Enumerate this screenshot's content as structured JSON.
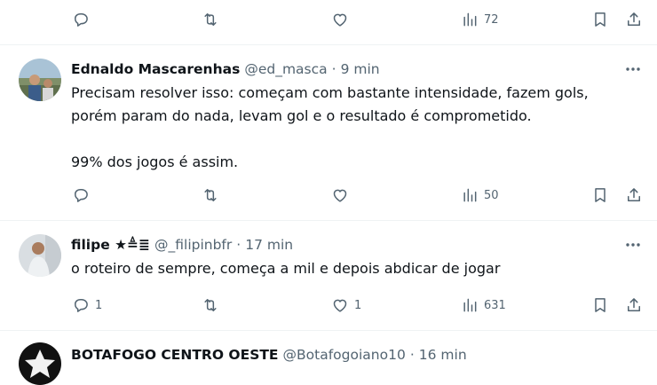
{
  "top_actions": {
    "reply_count": "",
    "retweet_count": "",
    "like_count": "",
    "views": "72"
  },
  "tweets": [
    {
      "name": "Ednaldo Mascarenhas",
      "handle": "@ed_masca",
      "sep": "·",
      "time": "9 min",
      "line1": "Precisam resolver isso: começam com bastante intensidade, fazem gols,",
      "line2": "porém param do nada, levam gol e o resultado é comprometido.",
      "line3": "99% dos jogos é assim.",
      "reply_count": "",
      "retweet_count": "",
      "like_count": "",
      "views": "50"
    },
    {
      "name": "filipe ★≜≣",
      "handle": "@_filipinbfr",
      "sep": "·",
      "time": "17 min",
      "line1": "o roteiro de sempre, começa a mil e depois abdicar de jogar",
      "reply_count": "1",
      "retweet_count": "",
      "like_count": "1",
      "views": "631"
    },
    {
      "name": "BOTAFOGO CENTRO OESTE",
      "handle": "@Botafogoiano10",
      "sep": "·",
      "time": "16 min"
    }
  ],
  "icons": {
    "reply": "reply-icon",
    "retweet": "retweet-icon",
    "like": "heart-icon",
    "views": "views-icon",
    "bookmark": "bookmark-icon",
    "share": "share-icon",
    "more": "more-icon"
  },
  "colors": {
    "text": "#0f1419",
    "muted": "#536471",
    "divider": "#eff3f4"
  }
}
